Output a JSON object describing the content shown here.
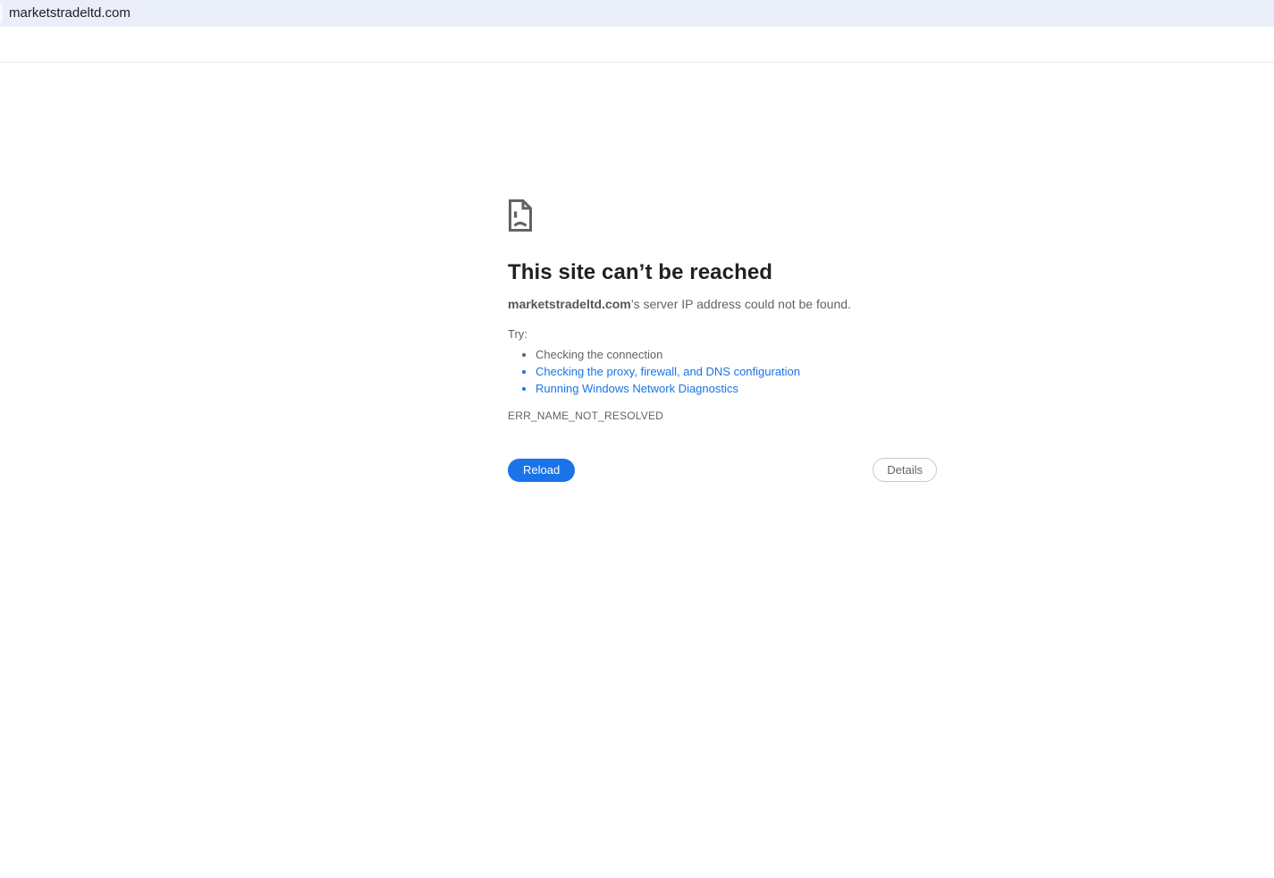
{
  "browser": {
    "tab_title": "marketstradeltd.com"
  },
  "error_page": {
    "icon": "sad-file-icon",
    "title": "This site can’t be reached",
    "host": "marketstradeltd.com",
    "message_rest": "’s server IP address could not be found.",
    "try_label": "Try:",
    "suggestions": [
      {
        "label": "Checking the connection",
        "is_link": false
      },
      {
        "label": "Checking the proxy, firewall, and DNS configuration",
        "is_link": true
      },
      {
        "label": "Running Windows Network Diagnostics",
        "is_link": true
      }
    ],
    "error_code": "ERR_NAME_NOT_RESOLVED",
    "reload_label": "Reload",
    "details_label": "Details"
  },
  "colors": {
    "tabbar_bg": "#e9eef9",
    "page_bg": "#ffffff",
    "link_blue": "#1a73e8",
    "reload_button_blue": "#1a73e8",
    "heading_text": "#202124",
    "body_text": "#5f6368",
    "divider": "#e5e6e9",
    "icon_gray": "#5f6368"
  }
}
